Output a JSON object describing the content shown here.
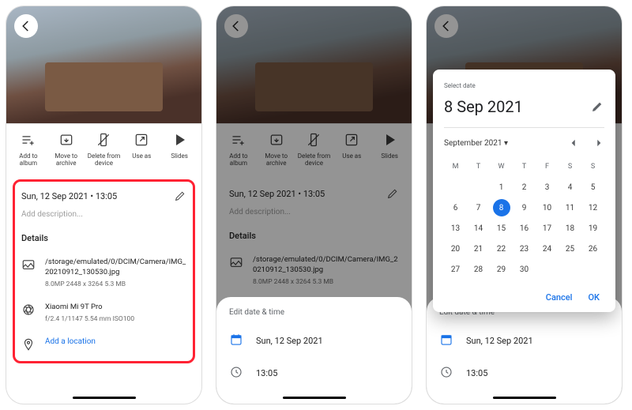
{
  "actions": {
    "add_album": "Add to album",
    "archive": "Move to archive",
    "delete": "Delete from device",
    "use_as": "Use as",
    "slides": "Slides"
  },
  "info": {
    "datetime": "Sun, 12 Sep 2021 • 13:05",
    "desc_placeholder": "Add description...",
    "details_title": "Details",
    "file_path": "/storage/emulated/0/DCIM/Camera/IMG_20210912_130530.jpg",
    "file_meta": "8.0MP   2448 x 3264   5.3 MB",
    "camera_model": "Xiaomi Mi 9T Pro",
    "camera_meta": "f/2.4   1/1147   5.54 mm   ISO100",
    "add_location": "Add a location"
  },
  "sheet": {
    "title": "Edit date & time",
    "date": "Sun, 12 Sep 2021",
    "time": "13:05"
  },
  "picker": {
    "select_label": "Select date",
    "selected": "8 Sep 2021",
    "month": "September 2021",
    "weekdays": [
      "M",
      "T",
      "W",
      "T",
      "F",
      "S",
      "S"
    ],
    "weeks": [
      [
        "",
        "",
        "1",
        "2",
        "3",
        "4",
        "5"
      ],
      [
        "6",
        "7",
        "8",
        "9",
        "10",
        "11",
        "12"
      ],
      [
        "13",
        "14",
        "15",
        "16",
        "17",
        "18",
        "19"
      ],
      [
        "20",
        "21",
        "22",
        "23",
        "24",
        "25",
        "26"
      ],
      [
        "27",
        "28",
        "29",
        "30",
        "",
        "",
        ""
      ]
    ],
    "selected_day": "8",
    "cancel": "Cancel",
    "ok": "OK"
  }
}
